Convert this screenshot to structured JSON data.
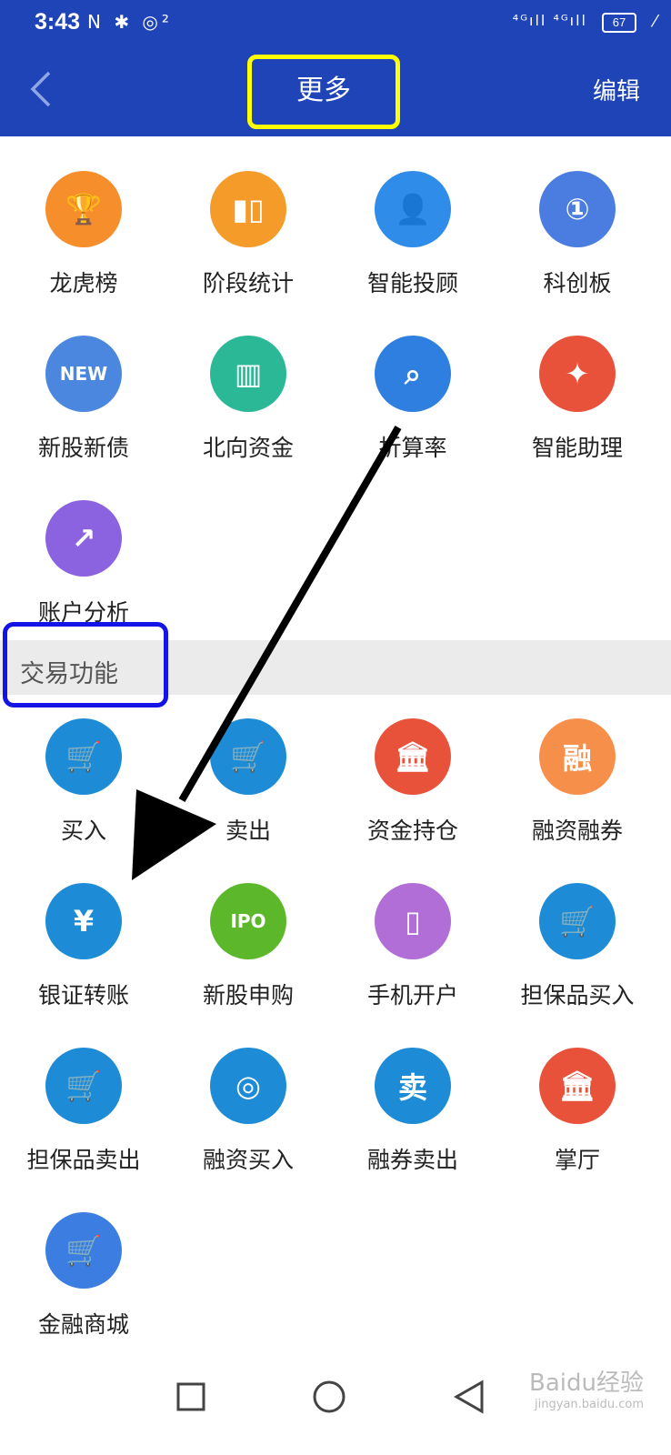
{
  "status": {
    "time": "3:43",
    "icons": "N ✱ ◎²",
    "signal": "⁴ᴳıll ⁴ᴳıll",
    "battery": "67",
    "leaf": "⁄"
  },
  "header": {
    "title": "更多",
    "edit": "编辑"
  },
  "general": [
    {
      "label": "龙虎榜",
      "icon": "trophy-icon",
      "color": "#f68e2c",
      "glyph": "🏆"
    },
    {
      "label": "阶段统计",
      "icon": "candlestick-icon",
      "color": "#f59b2a",
      "glyph": "▮▯"
    },
    {
      "label": "智能投顾",
      "icon": "advisor-icon",
      "color": "#2f8ce8",
      "glyph": "👤"
    },
    {
      "label": "科创板",
      "icon": "ticket-icon",
      "color": "#4a7ddf",
      "glyph": "①"
    },
    {
      "label": "新股新债",
      "icon": "new-stock-icon",
      "color": "#4b87de",
      "glyph": "NEW"
    },
    {
      "label": "北向资金",
      "icon": "northbound-icon",
      "color": "#2ab897",
      "glyph": "▥"
    },
    {
      "label": "折算率",
      "icon": "search-chart-icon",
      "color": "#2e7fe0",
      "glyph": "⌕"
    },
    {
      "label": "智能助理",
      "icon": "brain-icon",
      "color": "#e8523a",
      "glyph": "✦"
    },
    {
      "label": "账户分析",
      "icon": "trend-icon",
      "color": "#8b62e0",
      "glyph": "↗"
    }
  ],
  "section_title": "交易功能",
  "trade": [
    {
      "label": "买入",
      "icon": "cart-buy-icon",
      "color": "#1d8bd6",
      "glyph": "🛒"
    },
    {
      "label": "卖出",
      "icon": "cart-sell-icon",
      "color": "#1d8bd6",
      "glyph": "🛒"
    },
    {
      "label": "资金持仓",
      "icon": "bank-icon",
      "color": "#e8523a",
      "glyph": "🏛"
    },
    {
      "label": "融资融券",
      "icon": "margin-icon",
      "color": "#f68f4a",
      "glyph": "融"
    },
    {
      "label": "银证转账",
      "icon": "transfer-icon",
      "color": "#1d8bd6",
      "glyph": "¥"
    },
    {
      "label": "新股申购",
      "icon": "ipo-icon",
      "color": "#5cb82a",
      "glyph": "IPO"
    },
    {
      "label": "手机开户",
      "icon": "phone-icon",
      "color": "#b06ed6",
      "glyph": "▯"
    },
    {
      "label": "担保品买入",
      "icon": "collateral-buy-icon",
      "color": "#1d8bd6",
      "glyph": "🛒"
    },
    {
      "label": "担保品卖出",
      "icon": "collateral-sell-icon",
      "color": "#1d8bd6",
      "glyph": "🛒"
    },
    {
      "label": "融资买入",
      "icon": "coins-icon",
      "color": "#1d8bd6",
      "glyph": "◎"
    },
    {
      "label": "融券卖出",
      "icon": "voucher-icon",
      "color": "#1d8bd6",
      "glyph": "卖"
    },
    {
      "label": "掌厅",
      "icon": "hall-icon",
      "color": "#e8523a",
      "glyph": "🏛"
    },
    {
      "label": "金融商城",
      "icon": "shopping-cart-icon",
      "color": "#3b7de0",
      "glyph": "🛒"
    }
  ],
  "watermark": {
    "brand": "Baidu经验",
    "url": "jingyan.baidu.com"
  }
}
